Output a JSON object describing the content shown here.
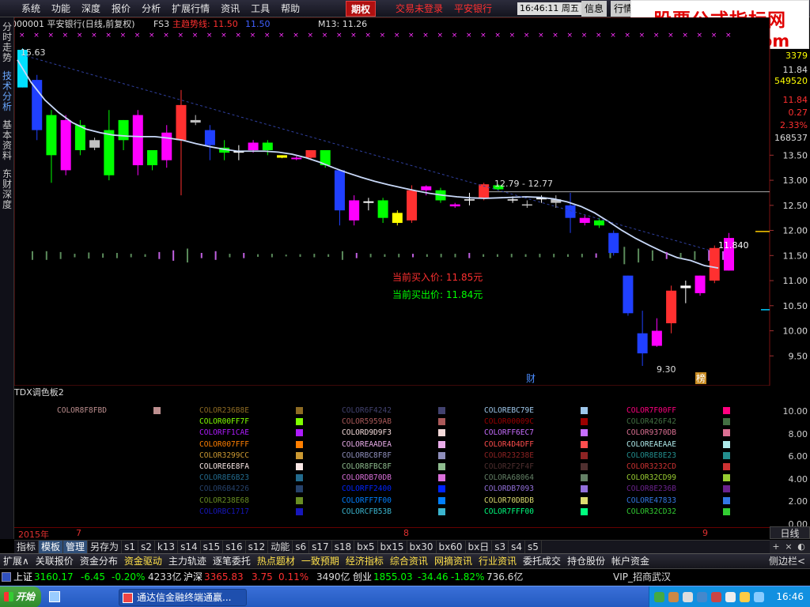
{
  "menu": {
    "items": [
      "系统",
      "功能",
      "深度",
      "报价",
      "分析",
      "扩展行情",
      "资讯",
      "工具",
      "帮助"
    ],
    "options_button": "期权",
    "login_status": "交易未登录",
    "stock_name": "平安银行",
    "clock": "16:46:11 周五",
    "info_button": "信息",
    "quote_button": "行情"
  },
  "watermark": {
    "title": "股票公式指标网",
    "url": "www.gszb.com"
  },
  "side_tabs": [
    "分时走势",
    "技术分析",
    "基本资料",
    "东财深度"
  ],
  "chart": {
    "header": {
      "code_name": "000001 平安银行(日线,前复权)",
      "indicator": "FS3",
      "trend_label": "主趋势线: 11.50",
      "trend_value2": "11.50",
      "m13_label": "M13: 11.26"
    },
    "annotations": {
      "buy_label": "当前买入价: 11.85元",
      "sell_label": "当前买出价: 11.84元",
      "range_label": "12.79 - 12.77",
      "high_label": "15.63",
      "low_label": "9.30",
      "last_label": "11.840",
      "cai_badge": "财",
      "bang_badge": "榜"
    },
    "right_info": {
      "volume": "3379",
      "price": "11.84",
      "amount": "549520",
      "price2": "11.84",
      "change": "0.27",
      "pct": "2.33%",
      "vol2": "168537"
    }
  },
  "chart_data": {
    "type": "candlestick",
    "ylim": [
      9.0,
      15.9
    ],
    "y_ticks": [
      "13.50",
      "13.00",
      "12.50",
      "12.00",
      "11.50",
      "11.00",
      "10.50",
      "10.00",
      "9.50"
    ],
    "candles": [
      {
        "o": 14.85,
        "h": 15.63,
        "l": 14.85,
        "c": 15.6,
        "col": "#00e0ff"
      },
      {
        "o": 15.0,
        "h": 15.1,
        "l": 13.8,
        "c": 14.0,
        "col": "#2040ff"
      },
      {
        "o": 13.5,
        "h": 14.4,
        "l": 12.95,
        "c": 14.3,
        "col": "#00ff00"
      },
      {
        "o": 14.2,
        "h": 14.3,
        "l": 13.1,
        "c": 13.2,
        "col": "#ff00ff"
      },
      {
        "o": 13.6,
        "h": 14.2,
        "l": 13.5,
        "c": 14.1,
        "col": "#00ff00"
      },
      {
        "o": 13.8,
        "h": 13.85,
        "l": 13.6,
        "c": 13.65,
        "col": "#c0c0c0"
      },
      {
        "o": 14.0,
        "h": 14.4,
        "l": 13.0,
        "c": 13.1,
        "col": "#00ff00"
      },
      {
        "o": 13.8,
        "h": 14.2,
        "l": 13.6,
        "c": 14.2,
        "col": "#00ff00"
      },
      {
        "o": 14.3,
        "h": 14.4,
        "l": 13.1,
        "c": 13.3,
        "col": "#ff00ff"
      },
      {
        "o": 13.3,
        "h": 13.6,
        "l": 13.2,
        "c": 13.6,
        "col": "#00ff00"
      },
      {
        "o": 13.4,
        "h": 14.1,
        "l": 13.25,
        "c": 13.95,
        "col": "#ff00ff"
      },
      {
        "o": 13.8,
        "h": 14.8,
        "l": 12.7,
        "c": 14.5,
        "col": "#ff3030"
      },
      {
        "o": 14.2,
        "h": 14.3,
        "l": 14.1,
        "c": 14.15,
        "col": "#c0c0c0"
      },
      {
        "o": 14.0,
        "h": 14.1,
        "l": 13.4,
        "c": 13.7,
        "col": "#2040ff"
      },
      {
        "o": 13.65,
        "h": 13.8,
        "l": 13.4,
        "c": 13.55,
        "col": "#00ff00"
      },
      {
        "o": 13.55,
        "h": 13.7,
        "l": 13.4,
        "c": 13.58,
        "col": "#ffffff"
      },
      {
        "o": 13.75,
        "h": 13.8,
        "l": 13.55,
        "c": 13.6,
        "col": "#ff00ff"
      },
      {
        "o": 13.6,
        "h": 13.8,
        "l": 13.5,
        "c": 13.75,
        "col": "#00ff00"
      },
      {
        "o": 13.5,
        "h": 13.5,
        "l": 13.44,
        "c": 13.45,
        "col": "#ffff00"
      },
      {
        "o": 13.45,
        "h": 13.48,
        "l": 13.4,
        "c": 13.42,
        "col": "#ff00ff"
      },
      {
        "o": 13.45,
        "h": 13.6,
        "l": 13.4,
        "c": 13.6,
        "col": "#ff3030"
      },
      {
        "o": 13.6,
        "h": 13.6,
        "l": 13.25,
        "c": 13.3,
        "col": "#00ff00"
      },
      {
        "o": 13.2,
        "h": 13.2,
        "l": 12.1,
        "c": 12.4,
        "col": "#2040ff"
      },
      {
        "o": 12.2,
        "h": 12.7,
        "l": 12.1,
        "c": 12.6,
        "col": "#ff00ff"
      },
      {
        "o": 12.55,
        "h": 12.65,
        "l": 12.4,
        "c": 12.58,
        "col": "#ffffff"
      },
      {
        "o": 12.6,
        "h": 12.65,
        "l": 12.15,
        "c": 12.25,
        "col": "#00ff00"
      },
      {
        "o": 12.15,
        "h": 12.4,
        "l": 12.1,
        "c": 12.35,
        "col": "#ffff00"
      },
      {
        "o": 12.2,
        "h": 12.9,
        "l": 12.15,
        "c": 12.8,
        "col": "#ff3030"
      },
      {
        "o": 12.8,
        "h": 12.9,
        "l": 12.7,
        "c": 12.88,
        "col": "#ff00ff"
      },
      {
        "o": 12.8,
        "h": 12.85,
        "l": 12.55,
        "c": 12.6,
        "col": "#00ff00"
      },
      {
        "o": 12.52,
        "h": 12.55,
        "l": 12.45,
        "c": 12.48,
        "col": "#ff00ff"
      },
      {
        "o": 12.6,
        "h": 12.75,
        "l": 12.5,
        "c": 12.62,
        "col": "#ffffff"
      },
      {
        "o": 12.65,
        "h": 12.95,
        "l": 12.6,
        "c": 12.92,
        "col": "#ff3030"
      },
      {
        "o": 12.9,
        "h": 12.92,
        "l": 12.8,
        "c": 12.82,
        "col": "#00ff00"
      },
      {
        "o": 12.62,
        "h": 12.68,
        "l": 12.55,
        "c": 12.6,
        "col": "#ffffff"
      },
      {
        "o": 12.5,
        "h": 12.6,
        "l": 12.45,
        "c": 12.52,
        "col": "#c0c0c0"
      },
      {
        "o": 12.62,
        "h": 12.7,
        "l": 12.55,
        "c": 12.65,
        "col": "#ffffff"
      },
      {
        "o": 12.55,
        "h": 12.7,
        "l": 12.45,
        "c": 12.62,
        "col": "#c0c0c0"
      },
      {
        "o": 12.5,
        "h": 12.75,
        "l": 11.95,
        "c": 12.25,
        "col": "#2040ff"
      },
      {
        "o": 12.25,
        "h": 12.3,
        "l": 12.1,
        "c": 12.15,
        "col": "#ff00ff"
      },
      {
        "o": 12.2,
        "h": 12.25,
        "l": 12.05,
        "c": 12.1,
        "col": "#00ff00"
      },
      {
        "o": 11.95,
        "h": 12.0,
        "l": 11.5,
        "c": 11.55,
        "col": "#2040ff"
      },
      {
        "o": 11.1,
        "h": 11.1,
        "l": 10.3,
        "c": 10.35,
        "col": "#2040ff"
      },
      {
        "o": 9.95,
        "h": 10.4,
        "l": 9.3,
        "c": 9.55,
        "col": "#2040ff"
      },
      {
        "o": 9.7,
        "h": 10.25,
        "l": 9.68,
        "c": 10.0,
        "col": "#ff00ff"
      },
      {
        "o": 10.15,
        "h": 10.9,
        "l": 9.95,
        "c": 10.8,
        "col": "#ff3030"
      },
      {
        "o": 10.85,
        "h": 11.0,
        "l": 10.55,
        "c": 10.9,
        "col": "#ffffff"
      },
      {
        "o": 11.1,
        "h": 11.1,
        "l": 10.7,
        "c": 10.75,
        "col": "#ff00ff"
      },
      {
        "o": 11.0,
        "h": 11.7,
        "l": 10.95,
        "c": 11.65,
        "col": "#ff3030"
      },
      {
        "o": 11.2,
        "h": 11.95,
        "l": 11.2,
        "c": 11.85,
        "col": "#ff00ff"
      }
    ],
    "trend_line": [
      15.4,
      14.95,
      14.6,
      14.35,
      14.15,
      14.02,
      13.95,
      13.9,
      13.88,
      13.87,
      13.87,
      13.84,
      13.8,
      13.73,
      13.67,
      13.62,
      13.58,
      13.58,
      13.58,
      13.56,
      13.52,
      13.45,
      13.36,
      13.25,
      13.15,
      13.06,
      12.98,
      12.91,
      12.85,
      12.79,
      12.74,
      12.7,
      12.67,
      12.65,
      12.64,
      12.65,
      12.66,
      12.67,
      12.66,
      12.63,
      12.57,
      12.48,
      12.35,
      12.18,
      12.0,
      11.84,
      11.7,
      11.57,
      11.46,
      11.4,
      11.3,
      11.25
    ],
    "vol_bars": [
      {
        "h": 0.5,
        "c": "g"
      },
      {
        "h": 0.5,
        "c": "g"
      },
      {
        "h": 0.4,
        "c": "g"
      },
      {
        "h": 0.2,
        "c": "g"
      },
      {
        "h": 0.35,
        "c": "g"
      },
      {
        "h": 0.25,
        "c": "g"
      },
      {
        "h": 0.3,
        "c": "g"
      },
      {
        "h": 0.2,
        "c": "g"
      },
      {
        "h": 0.15,
        "c": "g"
      },
      {
        "h": 0.4,
        "c": "p"
      },
      {
        "h": 0.6,
        "c": "p"
      },
      {
        "h": 0.8,
        "c": "g"
      },
      {
        "h": 0.3,
        "c": "p"
      },
      {
        "h": 0.5,
        "c": "p"
      },
      {
        "h": 0.2,
        "c": "g"
      },
      {
        "h": 0.3,
        "c": "p"
      },
      {
        "h": 0.15,
        "c": "g"
      },
      {
        "h": 0.2,
        "c": "g"
      },
      {
        "h": 0.1,
        "c": "g"
      },
      {
        "h": 0.15,
        "c": "g"
      },
      {
        "h": 0.2,
        "c": "g"
      },
      {
        "h": 0.15,
        "c": "g"
      },
      {
        "h": 0.5,
        "c": "g"
      },
      {
        "h": 0.3,
        "c": "p"
      },
      {
        "h": 0.2,
        "c": "g"
      },
      {
        "h": 0.15,
        "c": "g"
      },
      {
        "h": 0.2,
        "c": "g"
      },
      {
        "h": 0.2,
        "c": "p"
      },
      {
        "h": 0.15,
        "c": "g"
      },
      {
        "h": 0.2,
        "c": "g"
      },
      {
        "h": 0.2,
        "c": "g"
      },
      {
        "h": 0.3,
        "c": "p"
      },
      {
        "h": 0.15,
        "c": "g"
      },
      {
        "h": 0.15,
        "c": "g"
      },
      {
        "h": 0.2,
        "c": "g"
      },
      {
        "h": 0.15,
        "c": "g"
      },
      {
        "h": 0.2,
        "c": "g"
      },
      {
        "h": 0.2,
        "c": "g"
      },
      {
        "h": 0.15,
        "c": "g"
      },
      {
        "h": 0.2,
        "c": "g"
      },
      {
        "h": 0.25,
        "c": "p"
      },
      {
        "h": 0.3,
        "c": "g"
      },
      {
        "h": 1.0,
        "c": "g"
      },
      {
        "h": 0.8,
        "c": "g"
      },
      {
        "h": 0.6,
        "c": "g"
      },
      {
        "h": 0.4,
        "c": "p"
      },
      {
        "h": 0.3,
        "c": "g"
      },
      {
        "h": 0.5,
        "c": "g"
      },
      {
        "h": 0.6,
        "c": "p"
      },
      {
        "h": 0.5,
        "c": "p"
      }
    ]
  },
  "palette": {
    "title": "TDX调色板2",
    "columns": [
      [
        {
          "t": "COLOR8F8FBD",
          "c": "#BD8F8F"
        }
      ],
      [
        {
          "t": "COLOR236B8E",
          "c": "#8E6B23"
        },
        {
          "t": "COLOR00FF7F",
          "c": "#7FFF00"
        },
        {
          "t": "COLORFF1CAE",
          "c": "#AE1CFF"
        },
        {
          "t": "COLOR007FFF",
          "c": "#FF7F00"
        },
        {
          "t": "COLOR3299CC",
          "c": "#CC9932"
        },
        {
          "t": "COLORE6E8FA",
          "c": "#FAE8E6"
        },
        {
          "t": "COLOR8E6B23",
          "c": "#236B8E"
        },
        {
          "t": "COLOR6B4226",
          "c": "#26426B"
        },
        {
          "t": "COLOR238E68",
          "c": "#688E23"
        },
        {
          "t": "COLORBC1717",
          "c": "#1717BC"
        }
      ],
      [
        {
          "t": "COLOR6F4242",
          "c": "#42426F"
        },
        {
          "t": "COLOR5959AB",
          "c": "#AB5959"
        },
        {
          "t": "COLORD9D9F3",
          "c": "#F3D9D9"
        },
        {
          "t": "COLOREAADEA",
          "c": "#EAADEA"
        },
        {
          "t": "COLORBC8F8F",
          "c": "#8F8FBC"
        },
        {
          "t": "COLOR8FBC8F",
          "c": "#8FBC8F"
        },
        {
          "t": "COLORDB70DB",
          "c": "#DB70DB"
        },
        {
          "t": "COLORFF2400",
          "c": "#0024FF"
        },
        {
          "t": "COLORFF7F00",
          "c": "#007FFF"
        },
        {
          "t": "COLORCFB53B",
          "c": "#3BB5CF"
        }
      ],
      [
        {
          "t": "COLOREBC79E",
          "c": "#9EC7EB"
        },
        {
          "t": "COLOR00009C",
          "c": "#9C0000"
        },
        {
          "t": "COLORFF6EC7",
          "c": "#C76EFF"
        },
        {
          "t": "COLOR4D4DFF",
          "c": "#FF4D4D"
        },
        {
          "t": "COLOR23238E",
          "c": "#8E2323"
        },
        {
          "t": "COLOR2F2F4F",
          "c": "#4F2F2F"
        },
        {
          "t": "COLORA68064",
          "c": "#648066"
        },
        {
          "t": "COLORDB7093",
          "c": "#9370DB"
        },
        {
          "t": "COLOR70DBDB",
          "c": "#DBDB70"
        },
        {
          "t": "COLOR7FFF00",
          "c": "#00FF7F"
        }
      ],
      [
        {
          "t": "COLOR7F00FF",
          "c": "#FF007F"
        },
        {
          "t": "COLOR426F42",
          "c": "#426F42"
        },
        {
          "t": "COLOR9370DB",
          "c": "#DB7093"
        },
        {
          "t": "COLOREAEAAE",
          "c": "#AEEAEA"
        },
        {
          "t": "COLOR8E8E23",
          "c": "#238E8E"
        },
        {
          "t": "COLOR3232CD",
          "c": "#CD3232"
        },
        {
          "t": "COLOR32CD99",
          "c": "#99CD32"
        },
        {
          "t": "COLOR8E236B",
          "c": "#6B238E"
        },
        {
          "t": "COLORE47833",
          "c": "#3378E4"
        },
        {
          "t": "COLOR32CD32",
          "c": "#32CD32"
        }
      ]
    ],
    "axis": [
      "10.00",
      "8.00",
      "6.00",
      "4.00",
      "2.00",
      "0.00"
    ]
  },
  "timeline": {
    "year": "2015年",
    "m7": "7",
    "m8": "8",
    "m9": "9"
  },
  "period_label": "日线",
  "zoom_buttons": [
    "+",
    "×",
    "◐"
  ],
  "indicator_tabs": [
    "指标",
    "模板",
    "管理",
    "另存为",
    "s1",
    "s2",
    "k13",
    "s14",
    "s15",
    "s16",
    "s12",
    "动能",
    "s6",
    "s17",
    "s18",
    "bx5",
    "bx15",
    "bx30",
    "bx60",
    "bx日",
    "s3",
    "s4",
    "s5"
  ],
  "function_bar": {
    "items": [
      "扩展∧",
      "关联报价",
      "资金分布",
      "资金驱动",
      "主力轨迹",
      "逐笔委托",
      "热点题材",
      "一致预期",
      "经济指标",
      "综合资讯",
      "网摘资讯",
      "行业资讯",
      "委托成交",
      "持仓股份",
      "帐户资金"
    ],
    "hot": [
      false,
      false,
      false,
      true,
      false,
      false,
      true,
      true,
      true,
      true,
      true,
      true,
      false,
      false,
      false
    ],
    "sidebar": "侧边栏<"
  },
  "indexbar": {
    "sh_name": "上证",
    "sh_val": "3160.17",
    "sh_chg": "-6.45",
    "sh_pct": "-0.20%",
    "sh_amt": "4233亿",
    "sz_name": "沪深",
    "sz_val": "3365.83",
    "sz_chg": "3.75",
    "sz_pct": "0.11%",
    "sz_amt": "3490亿",
    "cy_name": "创业",
    "cy_val": "1855.03",
    "cy_chg": "-34.46",
    "cy_pct": "-1.82%",
    "cy_amt": "736.6亿",
    "vip": "VIP_招商武汉"
  },
  "taskbar": {
    "start": "开始",
    "app": "通达信金融终端通赢...",
    "clock": "16:46"
  }
}
